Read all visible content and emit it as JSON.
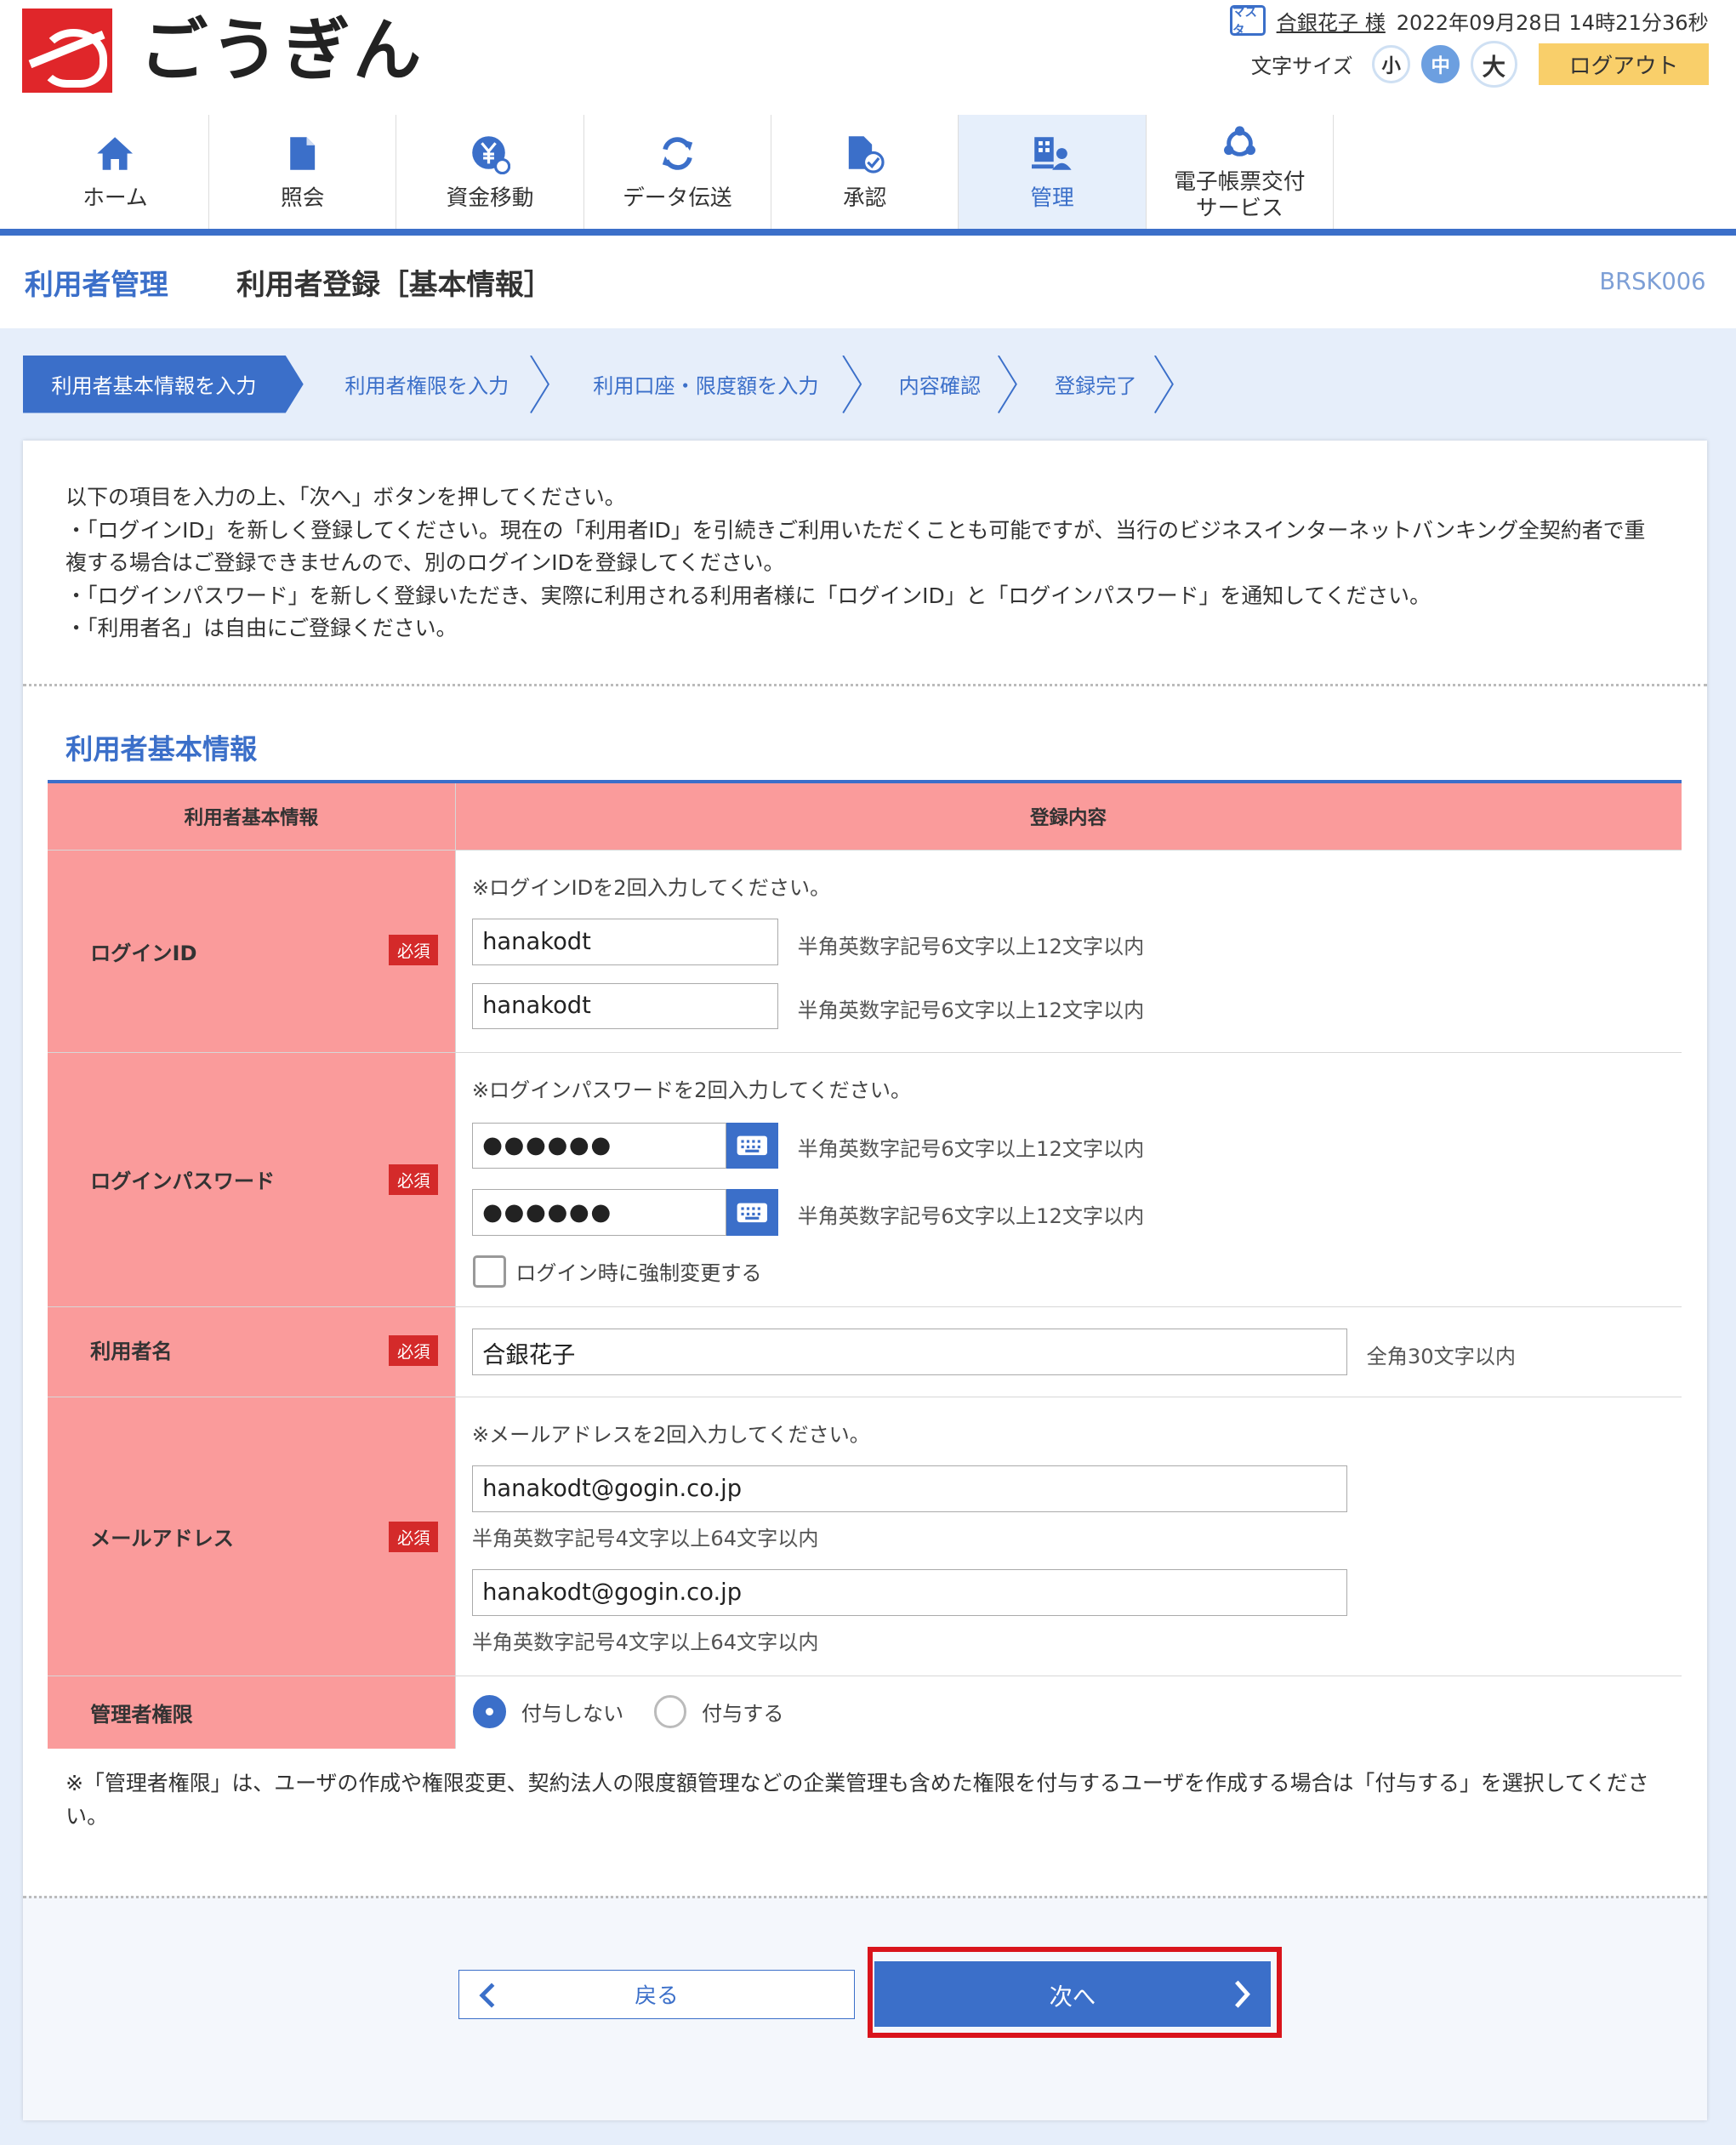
{
  "brand": {
    "name": "ごうぎん"
  },
  "user": {
    "badge": "マスタ",
    "name": "合銀花子 様",
    "datetime": "2022年09月28日 14時21分36秒"
  },
  "font_size": {
    "label": "文字サイズ",
    "small": "小",
    "medium": "中",
    "large": "大",
    "selected": "中"
  },
  "logout": "ログアウト",
  "nav": [
    {
      "label": "ホーム",
      "icon": "home-icon"
    },
    {
      "label": "照会",
      "icon": "document-icon"
    },
    {
      "label": "資金移動",
      "icon": "yen-transfer-icon"
    },
    {
      "label": "データ伝送",
      "icon": "refresh-icon"
    },
    {
      "label": "承認",
      "icon": "document-check-icon"
    },
    {
      "label": "管理",
      "icon": "admin-icon",
      "active": true
    },
    {
      "label1": "電子帳票交付",
      "label2": "サービス",
      "icon": "network-icon"
    }
  ],
  "title": {
    "section": "利用者管理",
    "main": "利用者登録［基本情報］",
    "code": "BRSK006"
  },
  "steps": [
    "利用者基本情報を入力",
    "利用者権限を入力",
    "利用口座・限度額を入力",
    "内容確認",
    "登録完了"
  ],
  "intro": [
    "以下の項目を入力の上、「次へ」ボタンを押してください。",
    "・「ログインID」を新しく登録してください。現在の「利用者ID」を引続きご利用いただくことも可能ですが、当行のビジネスインターネットバンキング全契約者で重複する場合はご登録できませんので、別のログインIDを登録してください。",
    "・「ログインパスワード」を新しく登録いただき、実際に利用される利用者様に「ログインID」と「ログインパスワード」を通知してください。",
    "・「利用者名」は自由にご登録ください。"
  ],
  "form": {
    "section_title": "利用者基本情報",
    "head_left": "利用者基本情報",
    "head_right": "登録内容",
    "required": "必須",
    "login_id": {
      "label": "ログインID",
      "note": "※ログインIDを2回入力してください。",
      "value1": "hanakodt",
      "value2": "hanakodt",
      "hint": "半角英数字記号6文字以上12文字以内"
    },
    "password": {
      "label": "ログインパスワード",
      "note": "※ログインパスワードを2回入力してください。",
      "value1": "●●●●●●",
      "value2": "●●●●●●",
      "hint": "半角英数字記号6文字以上12文字以内",
      "force_change": "ログイン時に強制変更する"
    },
    "user_name": {
      "label": "利用者名",
      "value": "合銀花子",
      "hint": "全角30文字以内"
    },
    "email": {
      "label": "メールアドレス",
      "note": "※メールアドレスを2回入力してください。",
      "value1": "hanakodt@gogin.co.jp",
      "value2": "hanakodt@gogin.co.jp",
      "hint": "半角英数字記号4文字以上64文字以内"
    },
    "admin": {
      "label": "管理者権限",
      "option_no": "付与しない",
      "option_yes": "付与する",
      "selected": "付与しない"
    }
  },
  "footnote": "※「管理者権限」は、ユーザの作成や権限変更、契約法人の限度額管理などの企業管理も含めた権限を付与するユーザを作成する場合は「付与する」を選択してください。",
  "buttons": {
    "back": "戻る",
    "next": "次へ"
  },
  "colors": {
    "accent": "#3b6fc9",
    "table_header": "#fa9b9b",
    "required": "#d42a2a",
    "highlight": "#d9141c",
    "logout": "#f9cf6a"
  }
}
